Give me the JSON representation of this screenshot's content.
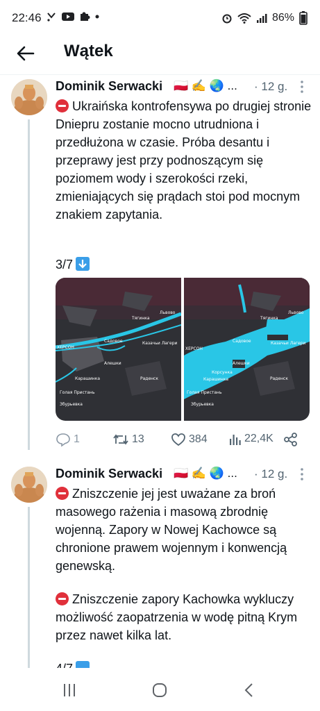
{
  "status": {
    "time": "22:46",
    "battery": "86%"
  },
  "header": {
    "title": "Wątek"
  },
  "tweets": [
    {
      "author": "Dominik Serwacki",
      "flair": "🇵🇱 ✍️ 🌏 ...",
      "time": "· 12 g.",
      "paragraphs": [
        "Ukraińska kontrofensywa po drugiej stronie Dniepru zostanie mocno utrudniona i przedłużona w czasie. Próba desantu i przeprawy jest przy podnoszącym się poziomem wody i szerokości rzeki, zmieniających się prądach stoi pod mocnym znakiem zapytania."
      ],
      "counter": "3/7",
      "replies": "1",
      "retweets": "13",
      "likes": "384",
      "views": "22,4K"
    },
    {
      "author": "Dominik Serwacki",
      "flair": "🇵🇱 ✍️ 🌏 ...",
      "time": "· 12 g.",
      "paragraphs": [
        "Zniszczenie jej jest uważane za broń masowego rażenia i masową zbrodnię wojenną. Zapory w Nowej Kachowce są chronione prawem wojennym i konwencją genewską.",
        "Zniszczenie zapory Kachowka wykluczy możliwość zaopatrzenia w wodę pitną Krym przez nawet kilka lat."
      ],
      "counter": "4/7"
    }
  ],
  "map_labels": {
    "tyaginka": "Тягинка",
    "lvovo": "Львово",
    "kherson": "ХЕРСОН",
    "sadovoe": "Садовое",
    "kazachi": "Казачьи Лагери",
    "aleshki": "Алешки",
    "radensk": "Раденск",
    "korsunka": "Корсунка",
    "karashinka": "Карашинка",
    "gola_pristan": "Голая Пристань",
    "zburyevka": "Збурьевка"
  },
  "colors": {
    "stop": "#e0303b",
    "water": "#29c6e6",
    "map_bg": "#2f3035"
  }
}
